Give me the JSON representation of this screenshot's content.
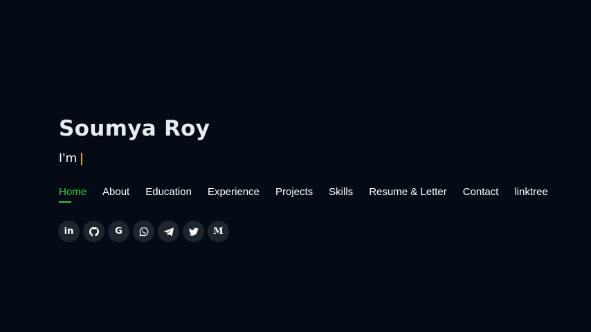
{
  "hero": {
    "name": "Soumya Roy",
    "typed_prefix": "I'm",
    "cursor_color": "#e0a030"
  },
  "nav": {
    "active_color": "#2ecc40",
    "items": [
      {
        "label": "Home",
        "active": true
      },
      {
        "label": "About"
      },
      {
        "label": "Education"
      },
      {
        "label": "Experience"
      },
      {
        "label": "Projects"
      },
      {
        "label": "Skills"
      },
      {
        "label": "Resume & Letter"
      },
      {
        "label": "Contact"
      },
      {
        "label": "linktree"
      }
    ]
  },
  "socials": [
    {
      "icon": "linkedin-icon",
      "glyph": "in"
    },
    {
      "icon": "github-icon"
    },
    {
      "icon": "google-icon",
      "glyph": "G"
    },
    {
      "icon": "whatsapp-icon"
    },
    {
      "icon": "telegram-icon"
    },
    {
      "icon": "twitter-icon"
    },
    {
      "icon": "medium-icon",
      "glyph": "M"
    }
  ],
  "colors": {
    "background": "#040b14",
    "social_bg": "#1e252f"
  }
}
